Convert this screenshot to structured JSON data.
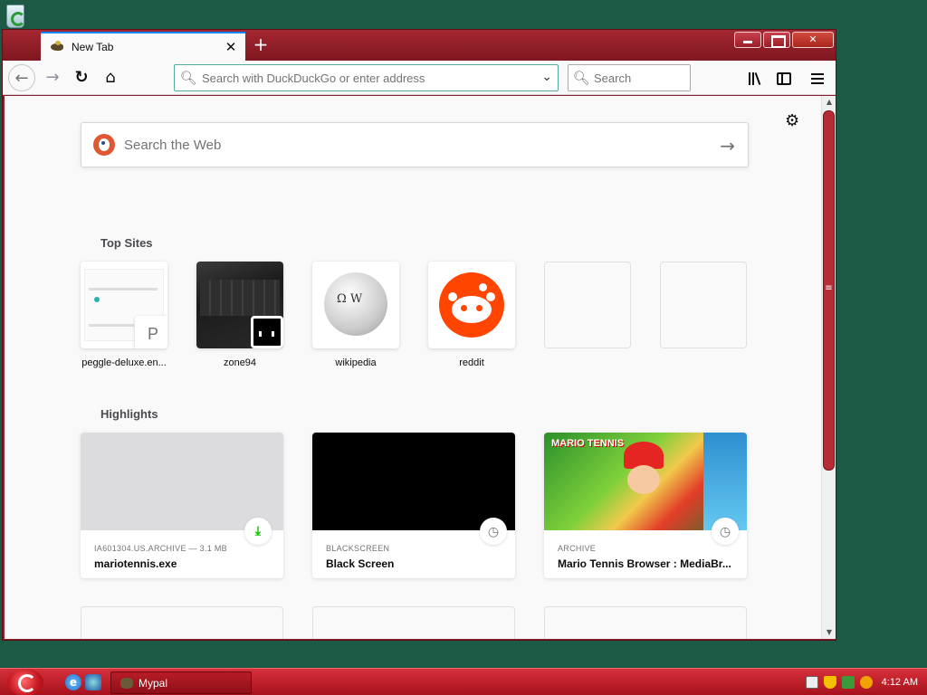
{
  "window": {
    "tab": {
      "title": "New Tab",
      "close": "✕"
    },
    "new_tab": "+"
  },
  "navbar": {
    "back": "←",
    "forward": "→",
    "reload": "↻",
    "home": "⌂",
    "url_placeholder": "Search with DuckDuckGo or enter address",
    "url_value": "",
    "search_placeholder": "Search",
    "dropdown": "⌄"
  },
  "newtab_page": {
    "websearch_placeholder": "Search the Web",
    "settings_icon": "⚙",
    "top_sites_heading": "Top Sites",
    "top_sites": [
      {
        "label": "peggle-deluxe.en...",
        "badge": "P"
      },
      {
        "label": "zone94"
      },
      {
        "label": "wikipedia"
      },
      {
        "label": "reddit"
      },
      {
        "label": ""
      },
      {
        "label": ""
      }
    ],
    "highlights_heading": "Highlights",
    "highlights": [
      {
        "context": "IA601304.US.ARCHIVE — 3.1 MB",
        "title": "mariotennis.exe",
        "status": "download"
      },
      {
        "context": "BLACKSCREEN",
        "title": "Black Screen",
        "status": "clock"
      },
      {
        "context": "ARCHIVE",
        "title": "Mario Tennis Browser : MediaBr...",
        "status": "clock"
      }
    ],
    "mario_thumb_text": "MARIO TENNIS"
  },
  "taskbar": {
    "task_label": "Mypal",
    "clock": "4:12 AM"
  },
  "colors": {
    "accent": "#0a84ff",
    "window_frame": "#8e1e28",
    "taskbar": "#c0202b",
    "desktop": "#1d5a45",
    "download_status": "#12bc00"
  }
}
